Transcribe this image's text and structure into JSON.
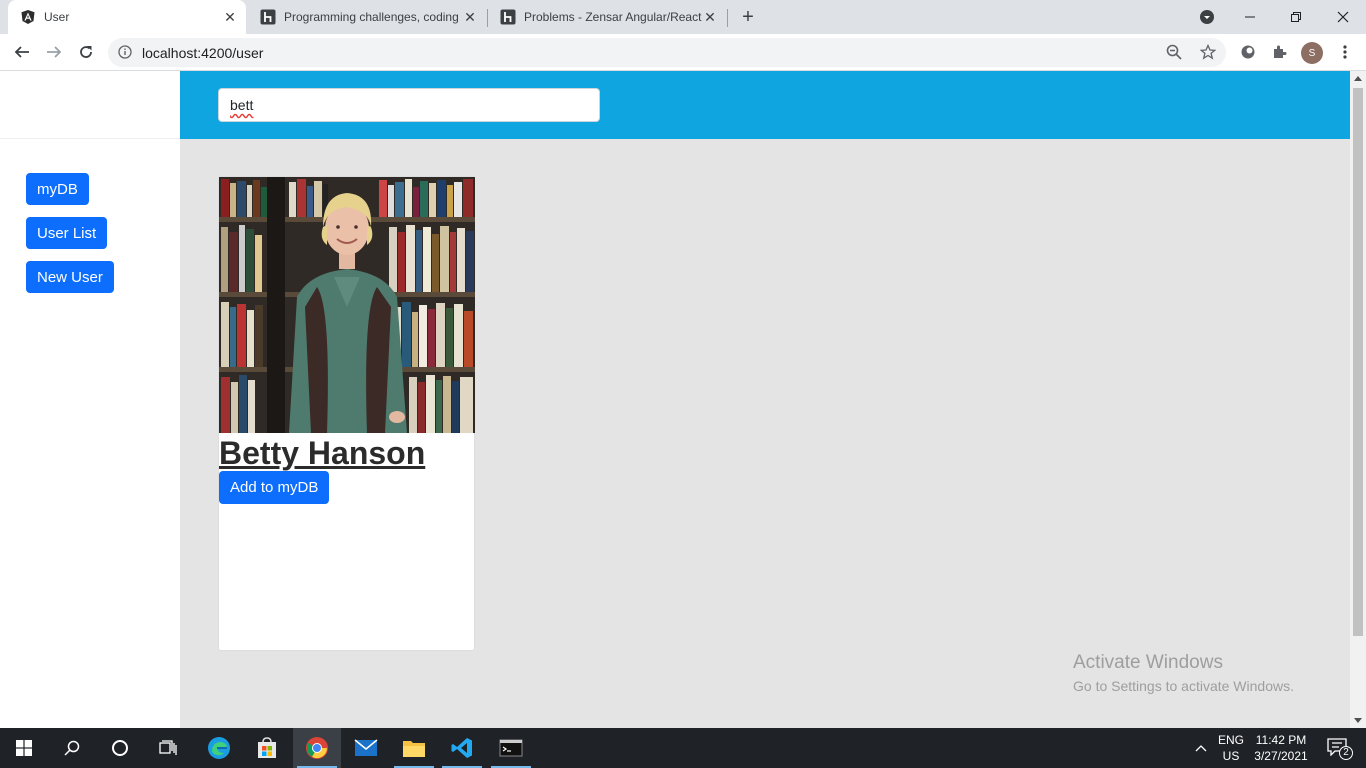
{
  "browser": {
    "tabs": [
      {
        "title": "User",
        "favicon": "angular-icon",
        "active": true
      },
      {
        "title": "Programming challenges, coding",
        "favicon": "hackerrank-icon",
        "active": false
      },
      {
        "title": "Problems - Zensar Angular/React",
        "favicon": "hackerrank-icon",
        "active": false
      }
    ],
    "url": "localhost:4200/user",
    "profile_initial": "S"
  },
  "search": {
    "value": "bett"
  },
  "sidebar": {
    "buttons": [
      {
        "label": "myDB"
      },
      {
        "label": "User List"
      },
      {
        "label": "New User"
      }
    ]
  },
  "user_card": {
    "name": "Betty Hanson",
    "add_label": "Add to myDB"
  },
  "watermark": {
    "line1": "Activate Windows",
    "line2": "Go to Settings to activate Windows."
  },
  "taskbar": {
    "lang_top": "ENG",
    "lang_bottom": "US",
    "time": "11:42 PM",
    "date": "3/27/2021",
    "notifications": "2"
  },
  "colors": {
    "header": "#0ea5e0",
    "primary": "#0d6efd",
    "main_bg": "#e4e4e4"
  }
}
